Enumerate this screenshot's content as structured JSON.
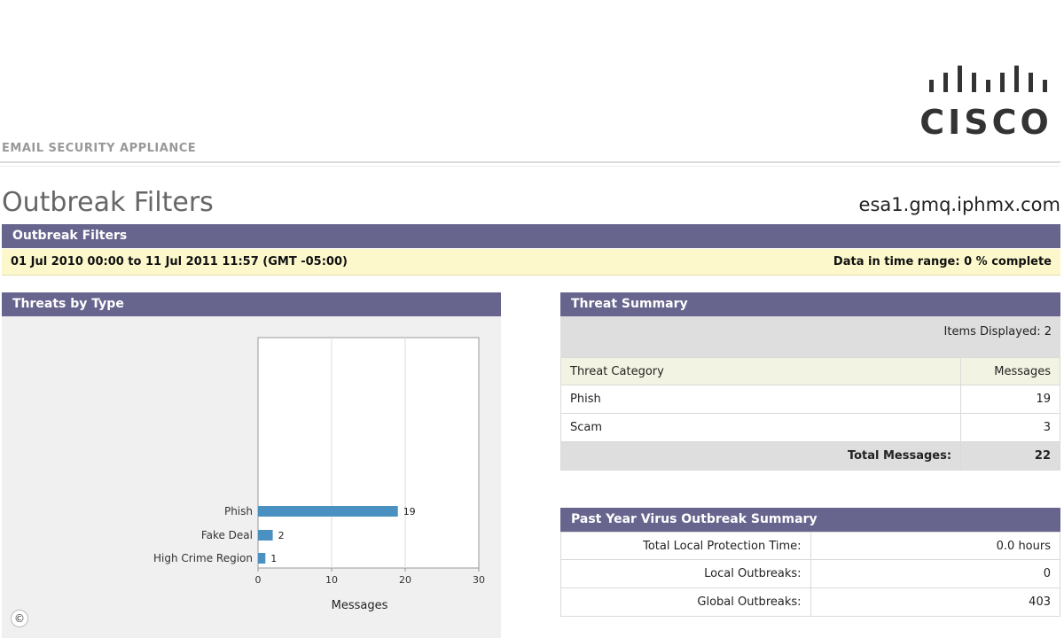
{
  "header": {
    "logo_text": "CISCO",
    "product": "EMAIL SECURITY APPLIANCE",
    "page_title": "Outbreak Filters",
    "hostname": "esa1.gmq.iphmx.com"
  },
  "report": {
    "banner": "Outbreak Filters",
    "date_range": "01 Jul 2010 00:00 to 11 Jul 2011 11:57 (GMT -05:00)",
    "completion": "Data in time range: 0 % complete"
  },
  "threats_by_type": {
    "title": "Threats by Type",
    "chart_data": {
      "type": "bar",
      "orientation": "horizontal",
      "categories": [
        "Phish",
        "Fake Deal",
        "High Crime Region"
      ],
      "values": [
        19,
        2,
        1
      ],
      "data_labels": [
        "19",
        "2",
        "1"
      ],
      "xlabel": "Messages",
      "xlim": [
        0,
        30
      ],
      "xticks": [
        "0",
        "10",
        "20",
        "30"
      ],
      "grid": true,
      "bar_color": "#4a90c0"
    }
  },
  "threat_summary": {
    "title": "Threat Summary",
    "items_displayed": "Items Displayed: 2",
    "columns": [
      "Threat Category",
      "Messages"
    ],
    "rows": [
      {
        "category": "Phish",
        "messages": "19"
      },
      {
        "category": "Scam",
        "messages": "3"
      }
    ],
    "total_label": "Total Messages:",
    "total_value": "22"
  },
  "virus_outbreak": {
    "title": "Past Year Virus Outbreak Summary",
    "rows": [
      {
        "label": "Total Local Protection Time:",
        "value": "0.0 hours"
      },
      {
        "label": "Local Outbreaks:",
        "value": "0"
      },
      {
        "label": "Global Outbreaks:",
        "value": "403"
      }
    ]
  },
  "footer": {
    "copyright_symbol": "©"
  },
  "colors": {
    "header_bar": "#67648e",
    "date_row": "#fcf8cc",
    "bar": "#4a90c0"
  }
}
